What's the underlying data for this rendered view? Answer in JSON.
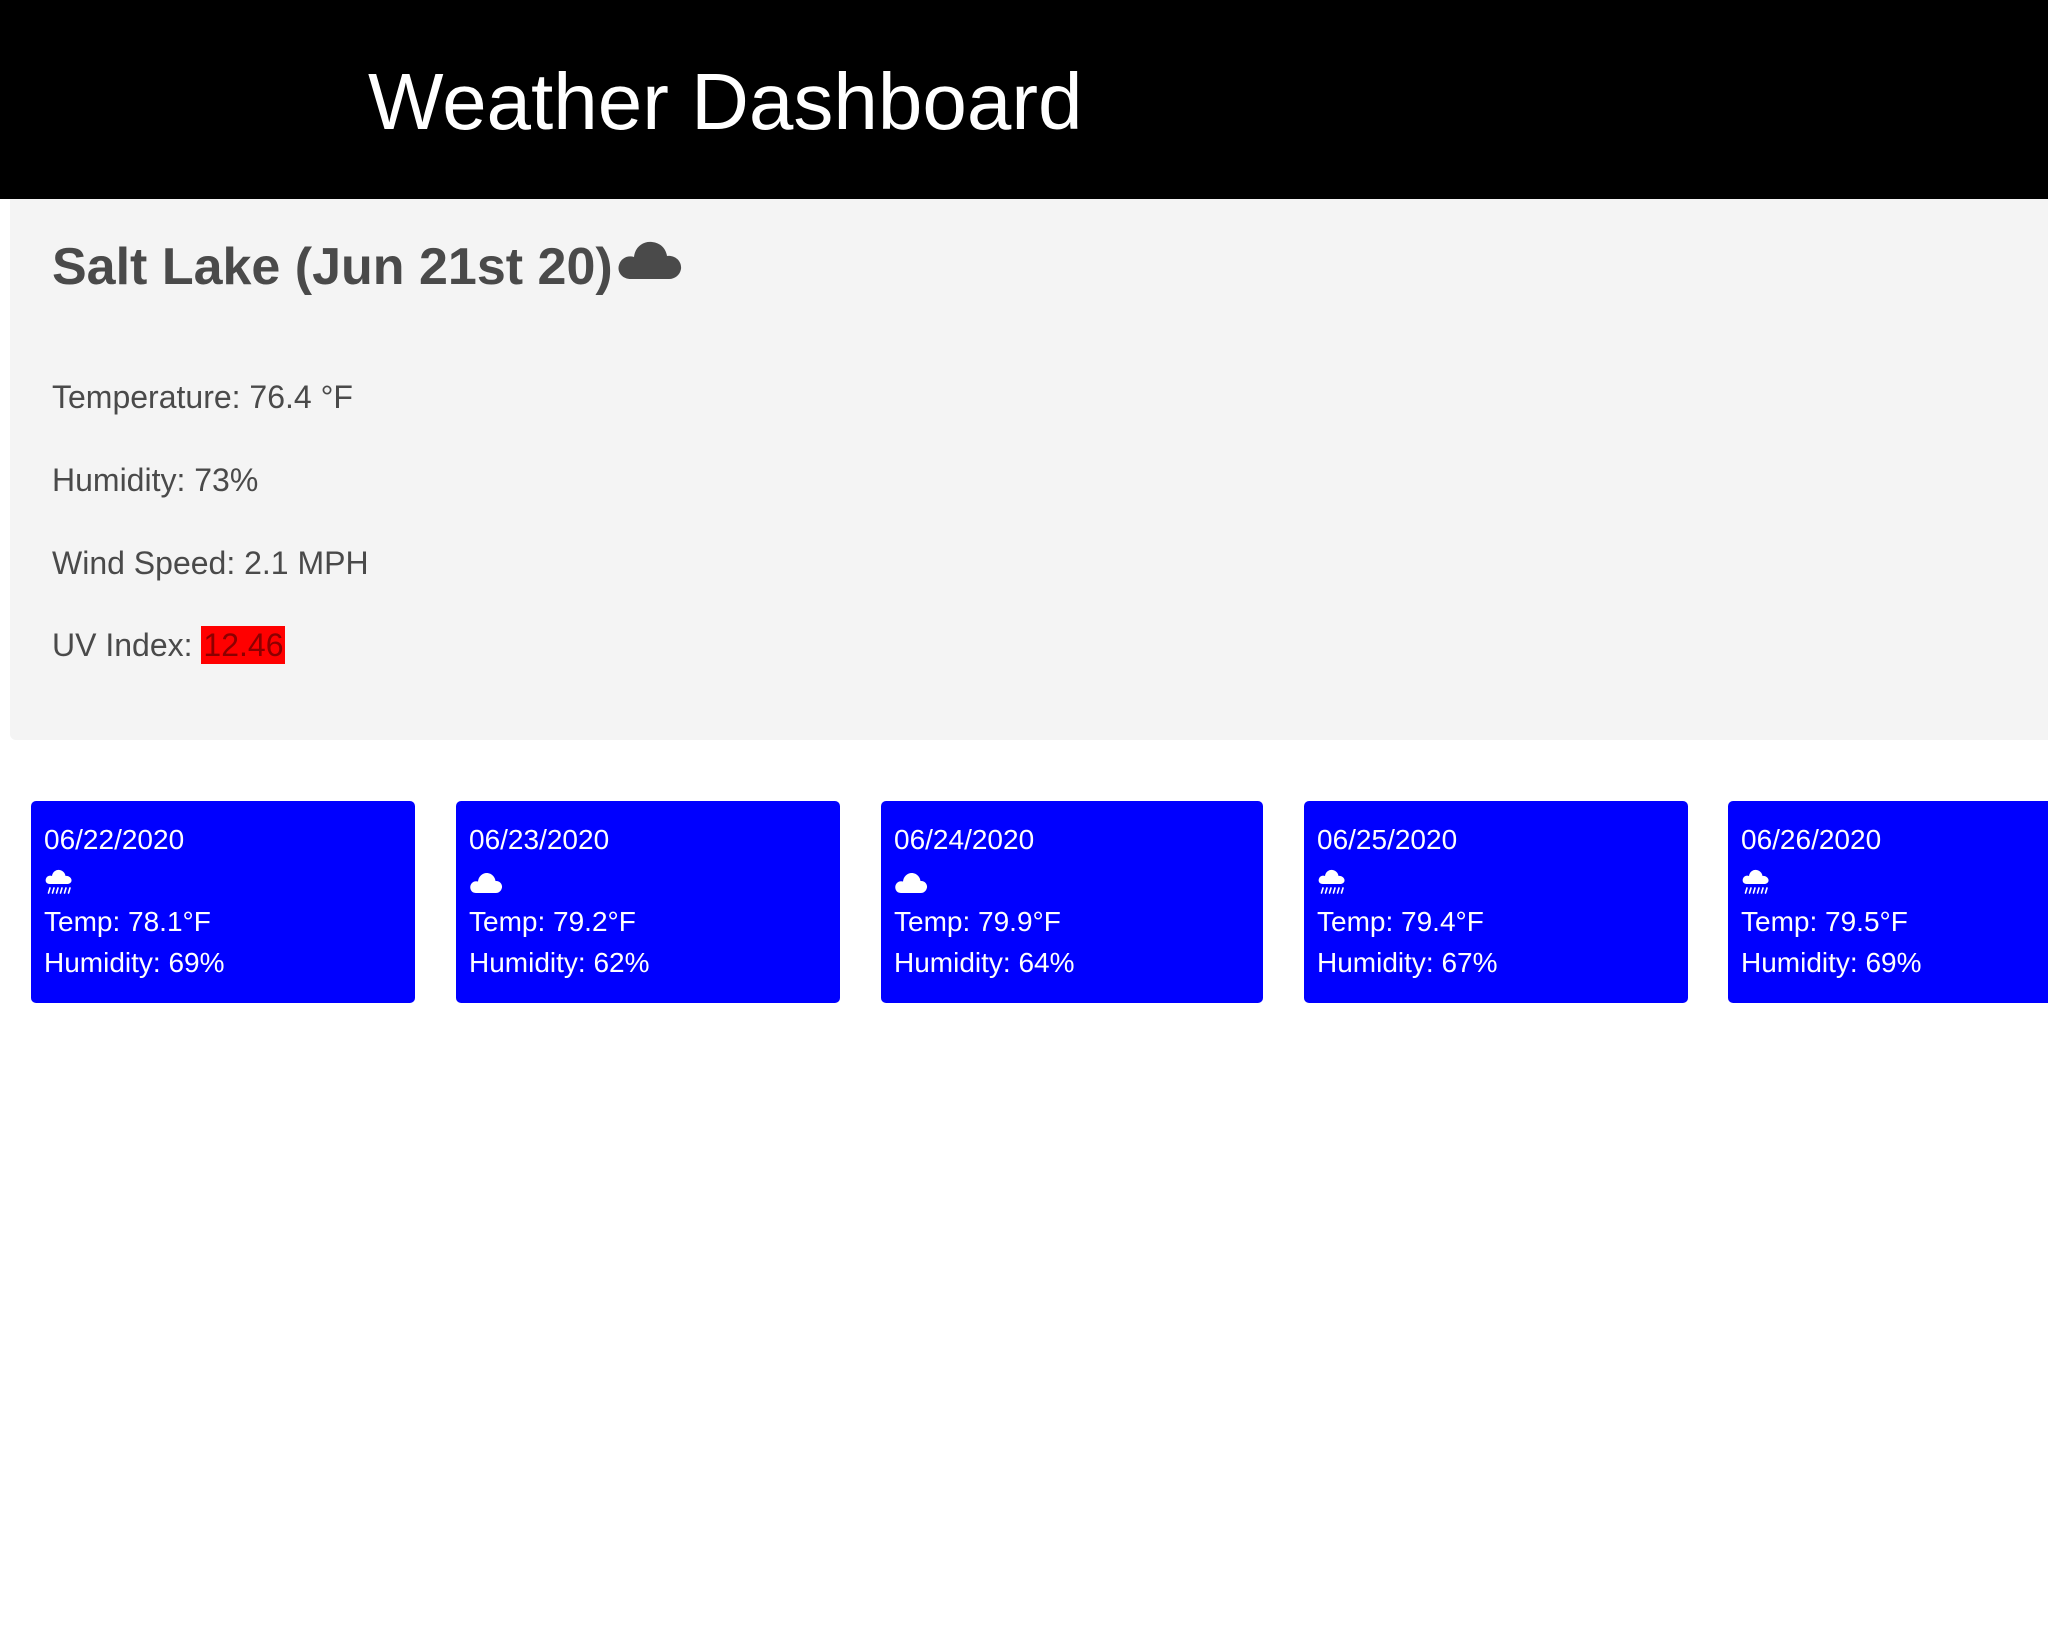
{
  "header": {
    "title": "Weather Dashboard"
  },
  "current": {
    "heading": "Salt Lake (Jun 21st 20)",
    "icon": "cloud-icon",
    "temperature": "Temperature: 76.4 °F",
    "humidity": "Humidity: 73%",
    "wind": "Wind Speed: 2.1 MPH",
    "uv_label": "UV Index: ",
    "uv_value": "12.46"
  },
  "forecast": [
    {
      "date": "06/22/2020",
      "icon": "cloud-rain-icon",
      "temp": "Temp: 78.1°F",
      "humidity": "Humidity: 69%"
    },
    {
      "date": "06/23/2020",
      "icon": "cloud-icon",
      "temp": "Temp: 79.2°F",
      "humidity": "Humidity: 62%"
    },
    {
      "date": "06/24/2020",
      "icon": "cloud-icon",
      "temp": "Temp: 79.9°F",
      "humidity": "Humidity: 64%"
    },
    {
      "date": "06/25/2020",
      "icon": "cloud-rain-icon",
      "temp": "Temp: 79.4°F",
      "humidity": "Humidity: 67%"
    },
    {
      "date": "06/26/2020",
      "icon": "cloud-rain-icon",
      "temp": "Temp: 79.5°F",
      "humidity": "Humidity: 69%"
    }
  ],
  "colors": {
    "header_bg": "#000000",
    "panel_bg": "#f4f4f4",
    "card_bg": "#0000ff",
    "uv_bg": "#ff0000"
  }
}
